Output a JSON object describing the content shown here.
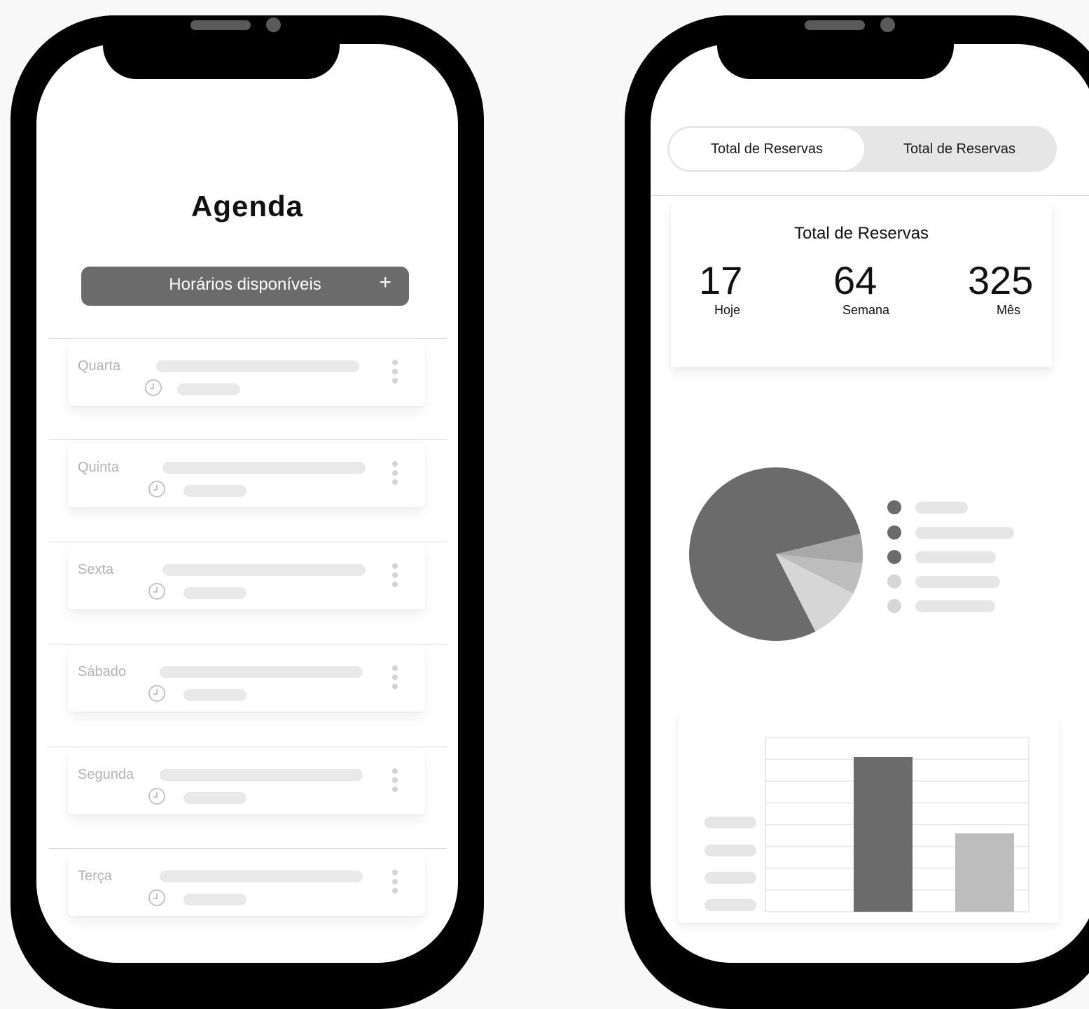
{
  "left_phone": {
    "title": "Agenda",
    "add_button": {
      "label": "Horários disponíveis",
      "icon": "plus-icon",
      "icon_glyph": "+"
    },
    "days": [
      {
        "name": "Quarta"
      },
      {
        "name": "Quinta"
      },
      {
        "name": "Sexta"
      },
      {
        "name": "Sábado"
      },
      {
        "name": "Segunda"
      },
      {
        "name": "Terça"
      }
    ]
  },
  "right_phone": {
    "toggle": {
      "option_a": "Total de Reservas",
      "option_b": "Total de Reservas",
      "selected": "option_a"
    },
    "stats": {
      "title": "Total de Reservas",
      "today": {
        "value": "17",
        "label": "Hoje"
      },
      "week": {
        "value": "64",
        "label": "Semana"
      },
      "month": {
        "value": "325",
        "label": "Mês"
      }
    },
    "colors": {
      "dark": "#6b6b6b",
      "mid": "#a8a8a8",
      "light": "#bdbdbd",
      "lighter": "#d6d6d6",
      "pill": "#e6e6e6"
    }
  },
  "chart_data": [
    {
      "type": "pie",
      "slices": [
        {
          "value": 0.787,
          "color": "#6b6b6b"
        },
        {
          "value": 0.055,
          "color": "#a8a8a8"
        },
        {
          "value": 0.058,
          "color": "#bdbdbd"
        },
        {
          "value": 0.1,
          "color": "#d6d6d6"
        }
      ],
      "legend": [
        {
          "color": "#6b6b6b"
        },
        {
          "color": "#6b6b6b"
        },
        {
          "color": "#6b6b6b"
        },
        {
          "color": "#d6d6d6"
        },
        {
          "color": "#d6d6d6"
        }
      ]
    },
    {
      "type": "bar",
      "categories": [
        "",
        ""
      ],
      "series": [
        {
          "values": [
            7.1,
            3.6
          ]
        }
      ],
      "bar_colors": [
        "#6b6b6b",
        "#bdbdbd"
      ],
      "ylim": [
        0,
        8
      ],
      "grid": true
    }
  ]
}
